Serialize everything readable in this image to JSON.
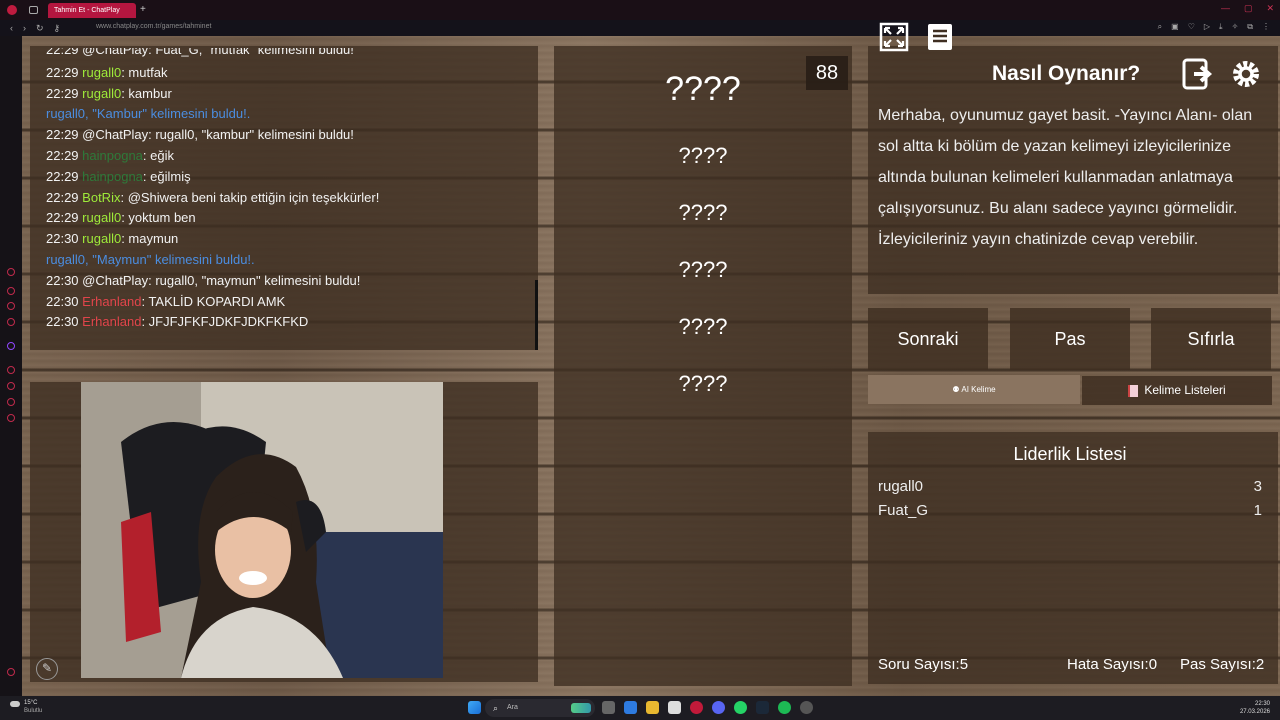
{
  "browser": {
    "tab_title": "Tahmin Et - ChatPlay",
    "url": "www.chatplay.com.tr/games/tahminet"
  },
  "chat": {
    "lines": [
      {
        "time": "22:29",
        "user": "@ChatPlay",
        "text": ": Fuat_G, \"mutfak\" kelimesini buldu!",
        "user_color": "#f2f2f2"
      },
      {
        "time": "22:29",
        "user": "rugall0",
        "text": ": mutfak",
        "user_color": "#9eea3a"
      },
      {
        "time": "22:29",
        "user": "rugall0",
        "text": ": kambur",
        "user_color": "#9eea3a"
      },
      {
        "time": "",
        "user": "",
        "text": "rugall0, \"Kambur\" kelimesini buldu!.",
        "user_color": "#4b8de0"
      },
      {
        "time": "22:29",
        "user": "@ChatPlay",
        "text": ": rugall0, \"kambur\" kelimesini buldu!",
        "user_color": "#f2f2f2"
      },
      {
        "time": "22:29",
        "user": "hainpogna",
        "text": ": eğik",
        "user_color": "#2e7a3a"
      },
      {
        "time": "22:29",
        "user": "hainpogna",
        "text": ": eğilmiş",
        "user_color": "#2e7a3a"
      },
      {
        "time": "22:29",
        "user": "BotRix",
        "text": ": @Shiwera beni takip ettiğin için teşekkürler!",
        "user_color": "#9eea3a"
      },
      {
        "time": "22:29",
        "user": "rugall0",
        "text": ": yoktum ben",
        "user_color": "#9eea3a"
      },
      {
        "time": "22:30",
        "user": "rugall0",
        "text": ": maymun",
        "user_color": "#9eea3a"
      },
      {
        "time": "",
        "user": "",
        "text": "rugall0, \"Maymun\" kelimesini buldu!.",
        "user_color": "#4b8de0"
      },
      {
        "time": "22:30",
        "user": "@ChatPlay",
        "text": ": rugall0, \"maymun\" kelimesini buldu!",
        "user_color": "#f2f2f2"
      },
      {
        "time": "22:30",
        "user": "Erhanland",
        "text": ": TAKLİD KOPARDI AMK",
        "user_color": "#e0454b"
      },
      {
        "time": "22:30",
        "user": "Erhanland",
        "text": ": JFJFJFKFJDKFJDKFKFKD",
        "user_color": "#e0454b"
      }
    ]
  },
  "game": {
    "timer": "88",
    "words": [
      "????",
      "????",
      "????",
      "????",
      "????",
      "????"
    ]
  },
  "how_to": {
    "title": "Nasıl Oynanır?",
    "text": "Merhaba, oyunumuz gayet basit. -Yayıncı Alanı- olan sol altta ki bölüm de yazan kelimeyi izleyicilerinize altında bulunan kelimeleri kullanmadan anlatmaya çalışıyorsunuz. Bu alanı sadece yayıncı görmelidir. İzleyicileriniz yayın chatinizde cevap verebilir."
  },
  "actions": {
    "next": "Sonraki",
    "pass": "Pas",
    "reset": "Sıfırla",
    "ai_word": "AI Kelime",
    "word_lists": "Kelime Listeleri"
  },
  "leaderboard": {
    "title": "Liderlik Listesi",
    "rows": [
      {
        "name": "rugall0",
        "score": "3"
      },
      {
        "name": "Fuat_G",
        "score": "1"
      }
    ]
  },
  "stats": {
    "questions": "Soru Sayısı:5",
    "errors": "Hata Sayısı:0",
    "passes": "Pas Sayısı:2"
  },
  "taskbar": {
    "weather_temp": "15°C",
    "weather_desc": "Bulutlu",
    "search_placeholder": "Ara",
    "time": "22:30",
    "date": "27.03.2026"
  },
  "colors": {
    "accent": "#b5163f",
    "panel": "#3e2e21"
  }
}
